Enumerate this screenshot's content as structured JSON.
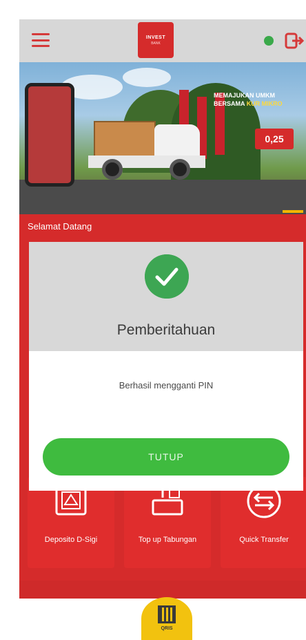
{
  "header": {
    "logo_line1": "INVEST",
    "logo_line2": "BANK",
    "menu_icon": "hamburger-menu-icon",
    "status_icon": "online-status-dot",
    "logout_icon": "logout-icon"
  },
  "banner": {
    "promo_line1": "MEMAJUKAN UMKM",
    "promo_line2_prefix": "BERSAMA",
    "promo_line2_highlight": "KUR MIKRO",
    "rate": "0,25"
  },
  "welcome": {
    "greeting": "Selamat Datang",
    "subtitle": ""
  },
  "menu": [
    {
      "label": "Deposito D-Sigi",
      "icon": "deposit-box-icon"
    },
    {
      "label": "Top up Tabungan",
      "icon": "top-up-savings-icon"
    },
    {
      "label": "Quick Transfer",
      "icon": "quick-transfer-icon"
    }
  ],
  "dialog": {
    "title": "Pemberitahuan",
    "message": "Berhasil mengganti PIN",
    "button": "TUTUP",
    "icon": "check-circle-icon"
  },
  "fab": {
    "label": "QRIS",
    "icon": "qr-code-icon"
  },
  "colors": {
    "brand_red": "#d52b2b",
    "success_green": "#3fbb3f",
    "accent_yellow": "#f2c20f"
  }
}
